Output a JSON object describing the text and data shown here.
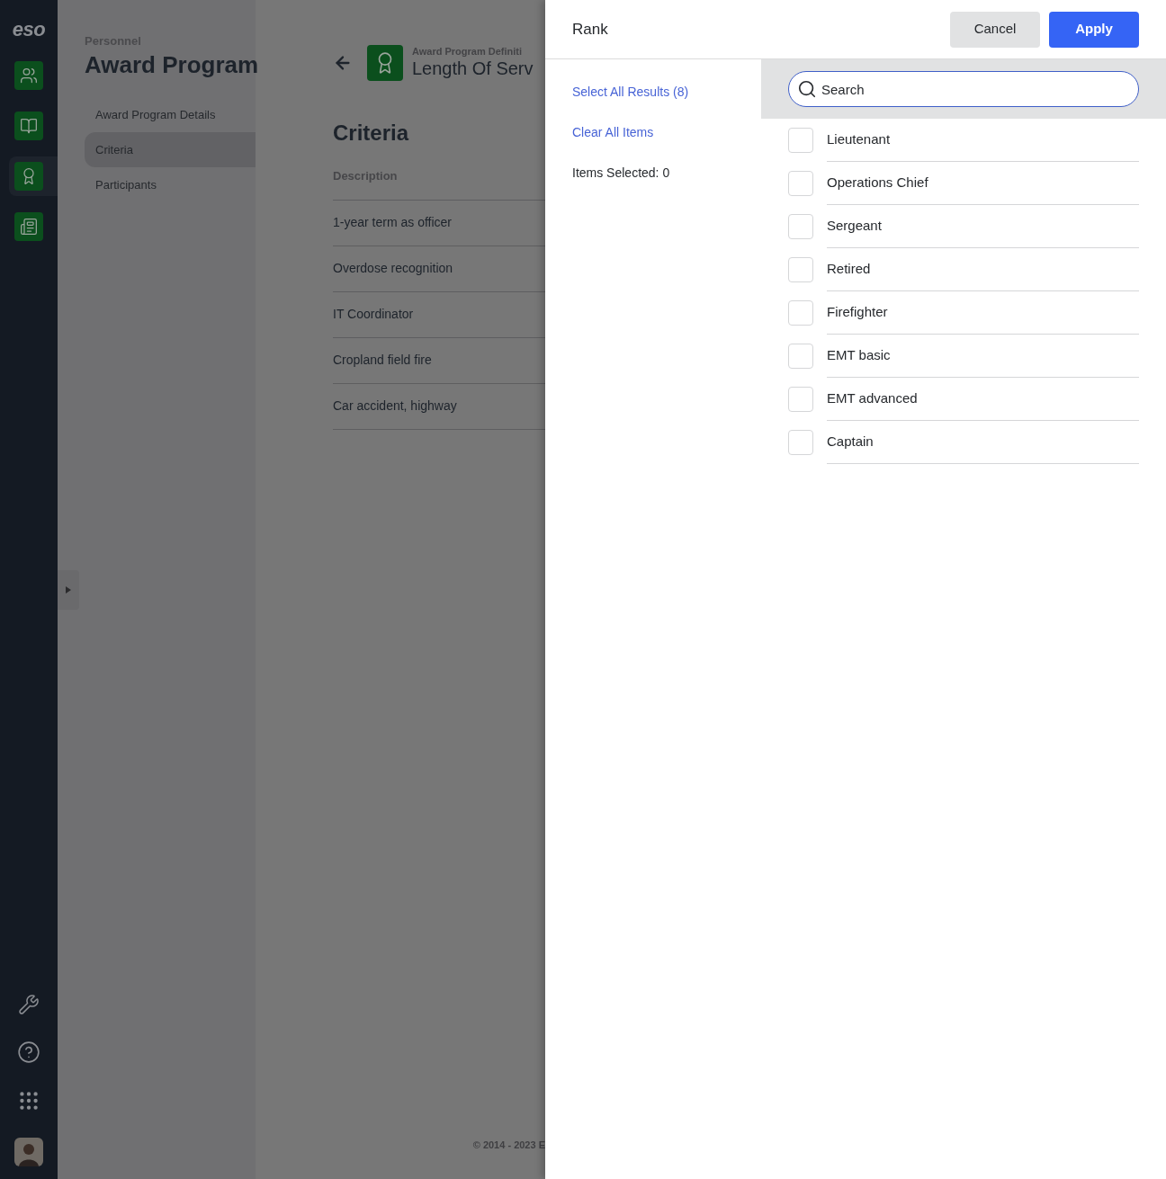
{
  "app_nav": {
    "logo": "eso"
  },
  "section": {
    "breadcrumb": "Personnel",
    "title": "Award Program",
    "items": [
      {
        "label": "Award Program Details",
        "selected": false
      },
      {
        "label": "Criteria",
        "selected": true
      },
      {
        "label": "Participants",
        "selected": false
      }
    ]
  },
  "detail": {
    "caption": "Award Program Definiti",
    "title": "Length Of Serv",
    "heading": "Criteria",
    "column": "Description",
    "rows": [
      "1-year term as officer",
      "Overdose recognition",
      "IT Coordinator",
      "Cropland field fire",
      "Car accident, highway"
    ],
    "footer": "© 2014 - 2023 E"
  },
  "drawer": {
    "title": "Rank",
    "buttons": [
      "Cancel",
      "Apply"
    ],
    "select_all": "Select All Results (8)",
    "clear_all": "Clear All Items",
    "selected_count": "Items Selected: 0",
    "search": {
      "placeholder": "Search"
    },
    "options": [
      {
        "label": "Lieutenant",
        "checked": false
      },
      {
        "label": "Operations Chief",
        "checked": false
      },
      {
        "label": "Sergeant",
        "checked": false
      },
      {
        "label": "Retired",
        "checked": false
      },
      {
        "label": "Firefighter",
        "checked": false
      },
      {
        "label": "EMT basic",
        "checked": false
      },
      {
        "label": "EMT advanced",
        "checked": false
      },
      {
        "label": "Captain",
        "checked": false
      }
    ]
  }
}
